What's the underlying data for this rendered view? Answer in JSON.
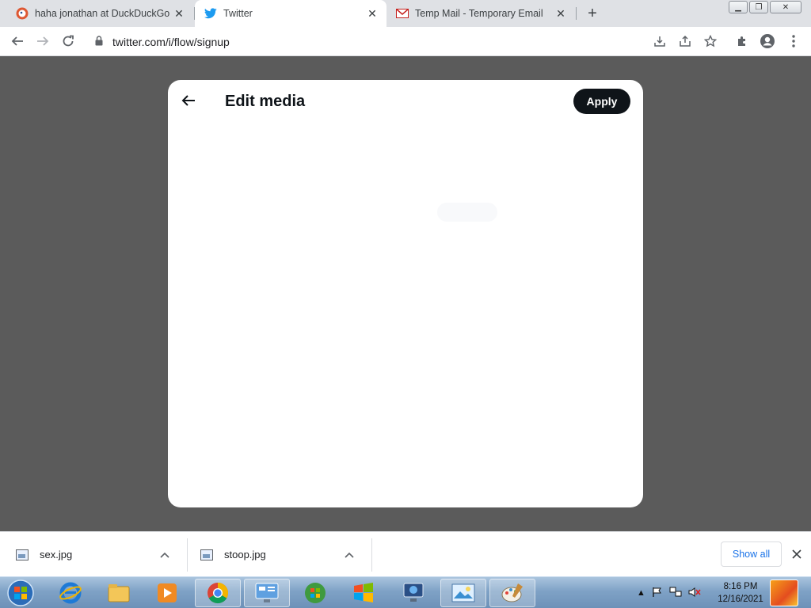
{
  "browser": {
    "tabs": [
      {
        "title": "haha jonathan at DuckDuckGo",
        "favicon": "duckduckgo-icon",
        "active": false
      },
      {
        "title": "Twitter",
        "favicon": "twitter-bird-icon",
        "active": true
      },
      {
        "title": "Temp Mail - Temporary Email",
        "favicon": "gmail-envelope-icon",
        "active": false
      }
    ],
    "address": "twitter.com/i/flow/signup"
  },
  "modal": {
    "title": "Edit media",
    "apply_label": "Apply"
  },
  "downloads": {
    "items": [
      {
        "name": "sex.jpg"
      },
      {
        "name": "stoop.jpg"
      }
    ],
    "show_all_label": "Show all"
  },
  "taskbar": {
    "apps": [
      "internet-explorer-icon",
      "file-explorer-icon",
      "media-player-icon",
      "chrome-icon",
      "control-panel-icon",
      "windows-orb-app-icon",
      "windows-flag-icon",
      "network-monitor-icon",
      "photo-viewer-icon",
      "paint-icon"
    ],
    "clock_time": "8:16 PM",
    "clock_date": "12/16/2021"
  },
  "colors": {
    "apply_bg": "#0f1419",
    "overlay": "#5b5b5b",
    "twitter_blue": "#1d9bf0",
    "link_blue": "#1a73e8"
  }
}
